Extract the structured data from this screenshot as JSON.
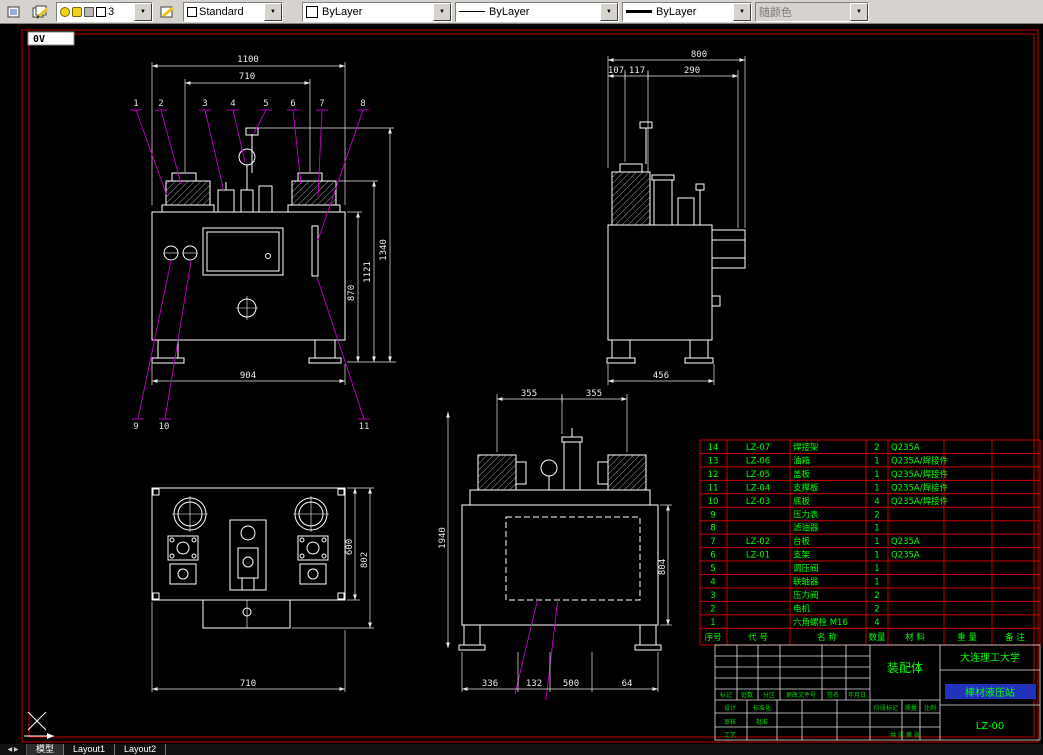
{
  "icons": {
    "dropdown": "▼"
  },
  "toolbar": {
    "layer_value": "3",
    "text_style": "Standard",
    "color": "ByLayer",
    "linetype": "ByLayer",
    "lineweight": "ByLayer",
    "plot_style": "随颜色"
  },
  "viewport_label": "0V",
  "tabs": {
    "model": "模型",
    "layout1": "Layout1",
    "layout2": "Layout2"
  },
  "drawing": {
    "front": {
      "w_total": "1100",
      "w_inner": "710",
      "h_total": "1340",
      "h_mid": "1121",
      "h_tank": "870",
      "base": "904",
      "balloons_top": [
        "1",
        "2",
        "3",
        "4",
        "5",
        "6",
        "7",
        "8"
      ],
      "balloons_bottom": [
        "9",
        "10",
        "11"
      ]
    },
    "side": {
      "w_total": "800",
      "a": "107",
      "b": "117",
      "c": "290",
      "base": "456"
    },
    "plan": {
      "base": "710",
      "h1": "600",
      "h2": "802"
    },
    "section": {
      "t1": "355",
      "t2": "355",
      "left": "1940",
      "right": "804",
      "b1": "336",
      "b2": "132",
      "b3": "500",
      "b4": "64"
    }
  },
  "parts_table": {
    "header": [
      "序号",
      "代 号",
      "名 称",
      "数量",
      "材 料",
      "重 量",
      "备 注"
    ],
    "rows": [
      {
        "no": "14",
        "code": "LZ-07",
        "name": "焊接架",
        "qty": "2",
        "material": "Q235A"
      },
      {
        "no": "13",
        "code": "LZ-06",
        "name": "油箱",
        "qty": "1",
        "material": "Q235A/焊接件"
      },
      {
        "no": "12",
        "code": "LZ-05",
        "name": "盖板",
        "qty": "1",
        "material": "Q235A/焊接件"
      },
      {
        "no": "11",
        "code": "LZ-04",
        "name": "支撑板",
        "qty": "1",
        "material": "Q235A/焊接件"
      },
      {
        "no": "10",
        "code": "LZ-03",
        "name": "底板",
        "qty": "4",
        "material": "Q235A/焊接件"
      },
      {
        "no": "9",
        "code": "",
        "name": "压力表",
        "qty": "2",
        "material": ""
      },
      {
        "no": "8",
        "code": "",
        "name": "滤油器",
        "qty": "1",
        "material": ""
      },
      {
        "no": "7",
        "code": "LZ-02",
        "name": "台板",
        "qty": "1",
        "material": "Q235A"
      },
      {
        "no": "6",
        "code": "LZ-01",
        "name": "支架",
        "qty": "1",
        "material": "Q235A"
      },
      {
        "no": "5",
        "code": "",
        "name": "调压阀",
        "qty": "1",
        "material": ""
      },
      {
        "no": "4",
        "code": "",
        "name": "联轴器",
        "qty": "1",
        "material": ""
      },
      {
        "no": "3",
        "code": "",
        "name": "压力阀",
        "qty": "2",
        "material": ""
      },
      {
        "no": "2",
        "code": "",
        "name": "电机",
        "qty": "2",
        "material": ""
      },
      {
        "no": "1",
        "code": "",
        "name": "六角螺栓 M16",
        "qty": "4",
        "material": ""
      }
    ]
  },
  "title_block": {
    "assembly": "装配体",
    "university": "大连理工大学",
    "title": "棒材液压站",
    "number": "LZ-00",
    "labels": {
      "mark": "标记",
      "count": "处数",
      "zone": "分区",
      "doc": "更改文件号",
      "sign": "签名",
      "date": "年月日",
      "design": "设计",
      "check": "审核",
      "craft": "工艺",
      "standard": "标准化",
      "approve": "批准",
      "stage": "阶段标记",
      "weight": "质量",
      "scale": "比例",
      "sheet": "共 张 第 张"
    }
  }
}
